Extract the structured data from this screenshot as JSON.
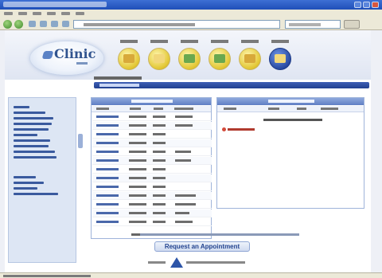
{
  "app": {
    "logo_text": "Clinic"
  },
  "modules": [
    {
      "icon": "folder-icon"
    },
    {
      "icon": "list-icon"
    },
    {
      "icon": "edit-icon"
    },
    {
      "icon": "people-icon"
    },
    {
      "icon": "notes-icon"
    },
    {
      "icon": "folder-active-icon",
      "active": true
    }
  ],
  "actions": {
    "request_button": "Request an Appointment"
  },
  "colors": {
    "accent": "#2a4a9e",
    "module_yellow": "#e2c633",
    "cancel_red": "#d34a3a"
  }
}
